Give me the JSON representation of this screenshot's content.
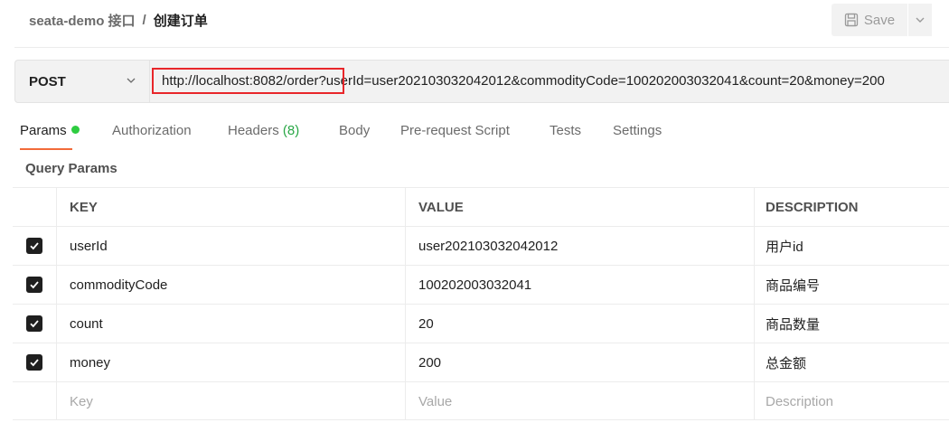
{
  "header": {
    "collection": "seata-demo 接口",
    "separator": "/",
    "request_name": "创建订单",
    "save_label": "Save",
    "save_icon": "save-icon",
    "caret_icon": "chevron-down-icon"
  },
  "request": {
    "method": "POST",
    "url": "http://localhost:8082/order?userId=user202103032042012&commodityCode=100202003032041&count=20&money=200",
    "highlight_color": "#e8262a"
  },
  "tabs": [
    {
      "label": "Params",
      "active": true,
      "indicator": "green-dot"
    },
    {
      "label": "Authorization"
    },
    {
      "label": "Headers",
      "count": "(8)"
    },
    {
      "label": "Body"
    },
    {
      "label": "Pre-request Script"
    },
    {
      "label": "Tests"
    },
    {
      "label": "Settings"
    }
  ],
  "params": {
    "section_title": "Query Params",
    "columns": {
      "key": "KEY",
      "value": "VALUE",
      "description": "DESCRIPTION"
    },
    "rows": [
      {
        "checked": true,
        "key": "userId",
        "value": "user202103032042012",
        "description": "用户id"
      },
      {
        "checked": true,
        "key": "commodityCode",
        "value": "100202003032041",
        "description": "商品编号"
      },
      {
        "checked": true,
        "key": "count",
        "value": "20",
        "description": "商品数量"
      },
      {
        "checked": true,
        "key": "money",
        "value": "200",
        "description": "总金额"
      }
    ],
    "placeholders": {
      "key": "Key",
      "value": "Value",
      "description": "Description"
    }
  }
}
